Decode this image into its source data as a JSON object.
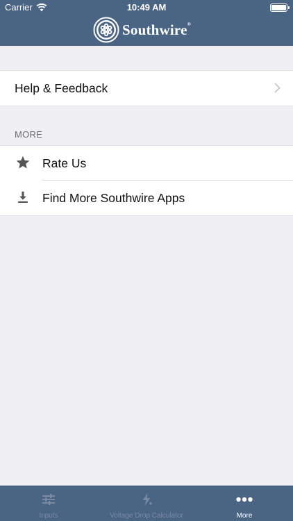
{
  "status_bar": {
    "carrier": "Carrier",
    "time": "10:49 AM",
    "battery_level": 1.0
  },
  "nav": {
    "brand": "Southwire",
    "brand_mark": "®",
    "background_color": "#4a6484"
  },
  "general": {
    "help_label": "Help & Feedback"
  },
  "more_section": {
    "header": "MORE",
    "items": [
      {
        "label": "Rate Us",
        "icon": "star-icon"
      },
      {
        "label": "Find More Southwire Apps",
        "icon": "download-icon"
      }
    ]
  },
  "tab_bar": {
    "tabs": [
      {
        "label": "Inputs",
        "icon": "sliders-icon",
        "active": false
      },
      {
        "label": "Voltage Drop Calculator",
        "icon": "lightning-icon",
        "active": false
      },
      {
        "label": "More",
        "icon": "more-dots-icon",
        "active": true
      }
    ]
  },
  "colors": {
    "page_background": "#efeff4",
    "bar_background": "#4a6484",
    "tab_inactive": "#7b8aa0",
    "tab_active": "#ffffff"
  }
}
